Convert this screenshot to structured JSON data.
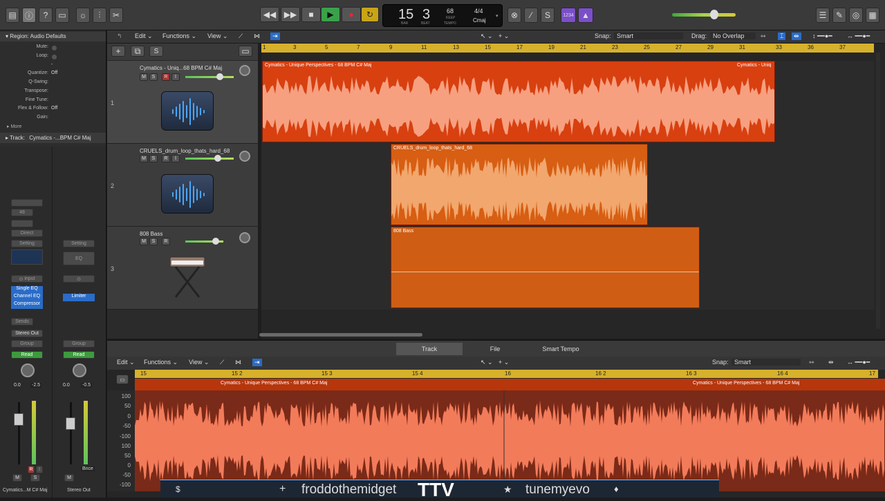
{
  "toolbar": {
    "lcd": {
      "bar": "15",
      "beat": "3",
      "bar_label": "BAR",
      "beat_label": "BEAT",
      "tempo": "68",
      "keep": "KEEP",
      "tempo_label": "TEMPO",
      "time_sig": "4/4",
      "key": "Cmaj"
    },
    "count_in": "1234"
  },
  "snap": {
    "label": "Snap:",
    "value": "Smart"
  },
  "drag": {
    "label": "Drag:",
    "value": "No Overlap"
  },
  "menus": {
    "edit": "Edit",
    "functions": "Functions",
    "view": "View"
  },
  "inspector": {
    "region_header": "Region: Audio Defaults",
    "rows": [
      {
        "k": "Mute:",
        "v": ""
      },
      {
        "k": "Loop:",
        "v": ""
      },
      {
        "k": "",
        "v": "-"
      },
      {
        "k": "Quantize:",
        "v": "Off"
      },
      {
        "k": "Q-Swing:",
        "v": ""
      },
      {
        "k": "Transpose:",
        "v": ""
      },
      {
        "k": "Fine Tune:",
        "v": ""
      },
      {
        "k": "Flex & Follow:",
        "v": "Off"
      },
      {
        "k": "Gain:",
        "v": ""
      }
    ],
    "more": "More",
    "track_label": "Track:",
    "track_name": "Cymatics -...BPM C# Maj",
    "strip1": {
      "value48": "48",
      "direct": "Direct",
      "setting": "Setting",
      "input": "input",
      "plugins": [
        "Single EQ",
        "Channel EQ",
        "Compressor"
      ],
      "sends": "Sends",
      "output": "Stereo Out",
      "group": "Group",
      "read": "Read",
      "pan": "0.0",
      "vol": "-2.5",
      "m": "M",
      "s": "S",
      "r": "R",
      "i": "I",
      "name": "Cymatics...M C# Maj"
    },
    "strip2": {
      "setting": "Setting",
      "eq": "EQ",
      "plugin": "Limiter",
      "group": "Group",
      "read": "Read",
      "pan": "0.0",
      "vol": "-0.5",
      "m": "M",
      "bnce": "Bnce",
      "name": "Stereo Out"
    }
  },
  "header_buttons": {
    "add": "+",
    "s": "S"
  },
  "tracks": [
    {
      "num": "1",
      "name": "Cymatics - Uniq...68 BPM C# Maj",
      "m": "M",
      "s": "S",
      "r": "R",
      "i": "I"
    },
    {
      "num": "2",
      "name": "CRUELS_drum_loop_thats_hard_68",
      "m": "M",
      "s": "S",
      "r": "R",
      "i": "I"
    },
    {
      "num": "3",
      "name": "808 Bass",
      "m": "M",
      "s": "S",
      "r": "R"
    }
  ],
  "ruler": [
    "1",
    "3",
    "5",
    "7",
    "9",
    "11",
    "13",
    "15",
    "17",
    "19",
    "21",
    "23",
    "25",
    "27",
    "29",
    "31",
    "33",
    "36",
    "37"
  ],
  "regions": {
    "r1a": "Cymatics - Unique Perspectives - 68 BPM C# Maj",
    "r1b": "Cymatics - Uniq",
    "r2": "CRUELS_drum_loop_thats_hard_68",
    "r3": "808 Bass"
  },
  "bottom": {
    "tabs": [
      "Track",
      "File",
      "Smart Tempo"
    ],
    "ruler": [
      "15",
      "15 2",
      "15 3",
      "15 4",
      "16",
      "16 2",
      "16 3",
      "16 4",
      "17"
    ],
    "region_a": "Cymatics - Unique Perspectives - 68 BPM C# Maj",
    "region_b": "Cymatics - Unique Perspectives - 68 BPM C# Maj",
    "yaxis": [
      "100",
      "50",
      "0",
      "-50",
      "-100",
      "100",
      "50",
      "0",
      "-50",
      "-100"
    ]
  },
  "banner": {
    "handle1": "froddothemidget",
    "logo": "TTV",
    "handle2": "tunemyevo"
  },
  "colors": {
    "region_red": "#d84010",
    "region_orange": "#d45a12",
    "region_amber": "#cf5e14",
    "ruler": "#d6b12c",
    "play": "#3aa14a",
    "accent": "#2a6cc8"
  }
}
